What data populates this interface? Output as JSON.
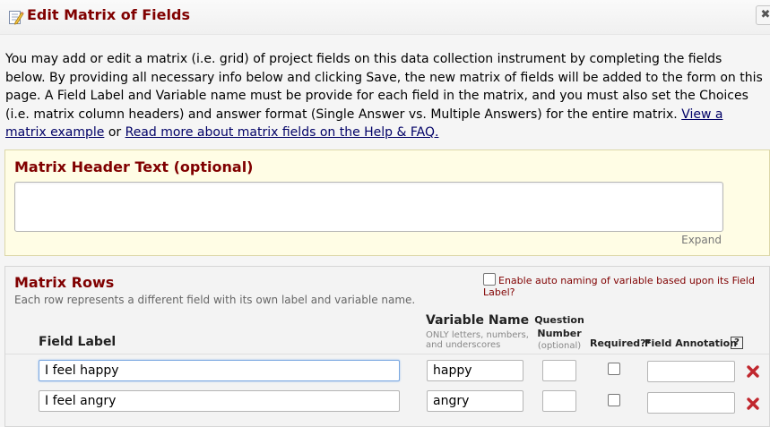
{
  "dialog": {
    "title": "Edit Matrix of Fields",
    "close_label": "✖"
  },
  "intro": {
    "text": "You may add or edit a matrix (i.e. grid) of project fields on this data collection instrument by completing the fields below. By providing all necessary info below and clicking Save, the new matrix of fields will be added to the form on this page. A Field Label and Variable name must be provide for each field in the matrix, and you must also set the Choices (i.e. matrix column headers) and answer format (Single Answer vs. Multiple Answers) for the entire matrix.",
    "link_example": "View a matrix example",
    "or_text": "or",
    "link_help": "Read more about matrix fields on the Help & FAQ."
  },
  "header_section": {
    "title": "Matrix Header Text (optional)",
    "textarea_value": "",
    "expand_label": "Expand"
  },
  "rows_section": {
    "title": "Matrix Rows",
    "description": "Each row represents a different field with its own label and variable name.",
    "auto_naming_label": "Enable auto naming of variable based upon its Field Label?",
    "auto_naming_checked": false,
    "columns": {
      "field_label": "Field Label",
      "variable_name": "Variable Name",
      "variable_hint": "ONLY letters, numbers, and underscores",
      "question_number": "Question Number",
      "question_number_hint": "(optional)",
      "required": "Required?*",
      "field_annotation": "Field Annotation",
      "help": "?"
    },
    "rows": [
      {
        "field_label": "I feel happy",
        "variable_name": "happy",
        "question_number": "",
        "required": false,
        "field_annotation": ""
      },
      {
        "field_label": "I feel angry",
        "variable_name": "angry",
        "question_number": "",
        "required": false,
        "field_annotation": ""
      }
    ]
  },
  "colors": {
    "accent": "#800000",
    "link": "#000066",
    "header_bg": "#fffde5",
    "delete_red": "#c0262d"
  },
  "icons": {
    "title": "edit-form-icon",
    "delete": "red-x-delete-icon"
  }
}
